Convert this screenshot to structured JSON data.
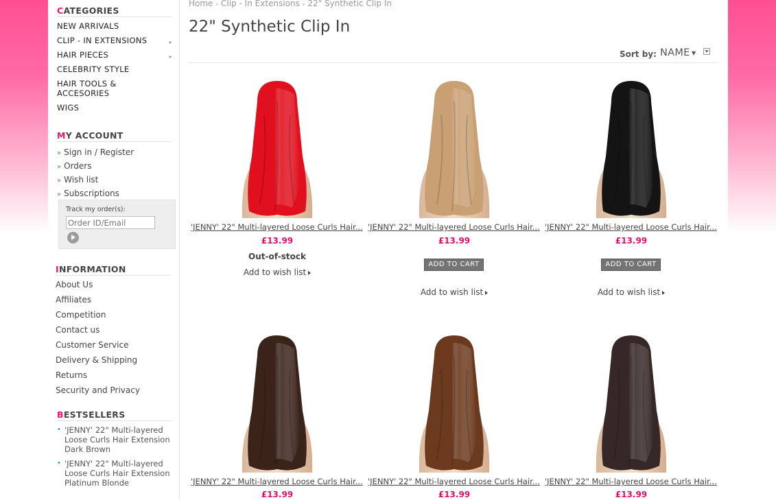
{
  "sidebar": {
    "categories": {
      "title_first": "C",
      "title_rest": "ATEGORIES",
      "items": [
        {
          "label": "NEW ARRIVALS"
        },
        {
          "label": "CLIP - IN EXTENSIONS"
        },
        {
          "label": "HAIR PIECES"
        },
        {
          "label": "CELEBRITY STYLE"
        },
        {
          "label": "HAIR TOOLS & ACCESORIES"
        },
        {
          "label": "WIGS"
        }
      ]
    },
    "account": {
      "title_first": "M",
      "title_rest": "Y ACCOUNT",
      "items": [
        {
          "label": "Sign in / Register"
        },
        {
          "label": "Orders"
        },
        {
          "label": "Wish list"
        },
        {
          "label": "Subscriptions"
        }
      ]
    },
    "track": {
      "label": "Track my order(s):",
      "placeholder": "Order ID/Email"
    },
    "information": {
      "title_first": "I",
      "title_rest": "NFORMATION",
      "items": [
        {
          "label": "About Us"
        },
        {
          "label": "Affiliates"
        },
        {
          "label": "Competition"
        },
        {
          "label": "Contact us"
        },
        {
          "label": "Customer Service"
        },
        {
          "label": "Delivery & Shipping"
        },
        {
          "label": "Returns"
        },
        {
          "label": "Security and Privacy"
        }
      ]
    },
    "bestsellers": {
      "title_first": "B",
      "title_rest": "ESTSELLERS",
      "items": [
        {
          "label": "'JENNY' 22\" Multi-layered Loose Curls Hair Extension Dark Brown"
        },
        {
          "label": "'JENNY' 22\" Multi-layered Loose Curls Hair Extension Platinum Blonde"
        }
      ]
    }
  },
  "breadcrumb": [
    "Home",
    "Clip - In Extensions",
    "22\" Synthetic Clip In"
  ],
  "page_title": "22\" Synthetic Clip In",
  "sort": {
    "label": "Sort by:",
    "value": "NAME"
  },
  "products": [
    {
      "name": "'JENNY' 22\" Multi-layered Loose Curls Hair...",
      "price": "£13.99",
      "status": "Out-of-stock",
      "wish_label": "Add to wish list",
      "hair_color": "#e0101e"
    },
    {
      "name": "'JENNY' 22\" Multi-layered Loose Curls Hair...",
      "price": "£13.99",
      "cart_label": "ADD TO CART",
      "wish_label": "Add to wish list",
      "hair_color": "#c9a074"
    },
    {
      "name": "'JENNY' 22\" Multi-layered Loose Curls Hair...",
      "price": "£13.99",
      "cart_label": "ADD TO CART",
      "wish_label": "Add to wish list",
      "hair_color": "#141414"
    },
    {
      "name": "'JENNY' 22\" Multi-layered Loose Curls Hair...",
      "price": "£13.99",
      "hair_color": "#3a2318"
    },
    {
      "name": "'JENNY' 22\" Multi-layered Loose Curls Hair...",
      "price": "£13.99",
      "hair_color": "#6b3a1e"
    },
    {
      "name": "'JENNY' 22\" Multi-layered Loose Curls Hair...",
      "price": "£13.99",
      "hair_color": "#352826"
    }
  ],
  "colors": {
    "accent": "#e0186c",
    "price": "#d8126b",
    "background_pink": "#ff4f93"
  }
}
